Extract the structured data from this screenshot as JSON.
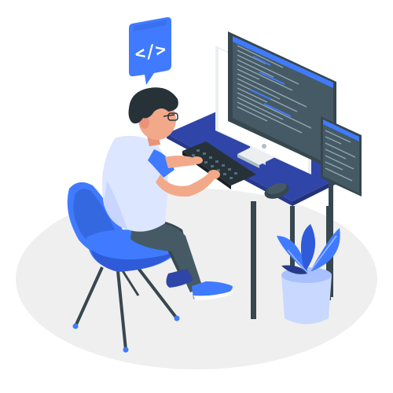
{
  "illustration": {
    "code_badge_text": "</>",
    "colors": {
      "primary": "#407BFF",
      "dark_blue": "#263A8C",
      "desk_top": "#2F45A8",
      "charcoal": "#37474F",
      "dark_charcoal": "#263238",
      "screen_bg": "#3B4A57",
      "floor": "#EBEBEB",
      "shirt": "#DCE6FF",
      "skin": "#F2A98A",
      "hair": "#263238",
      "plant_pot": "#C9D8FF"
    },
    "icons": [
      "code-badge-icon",
      "monitor-icon",
      "keyboard-icon",
      "mouse-icon",
      "chair-icon",
      "plant-icon"
    ]
  }
}
